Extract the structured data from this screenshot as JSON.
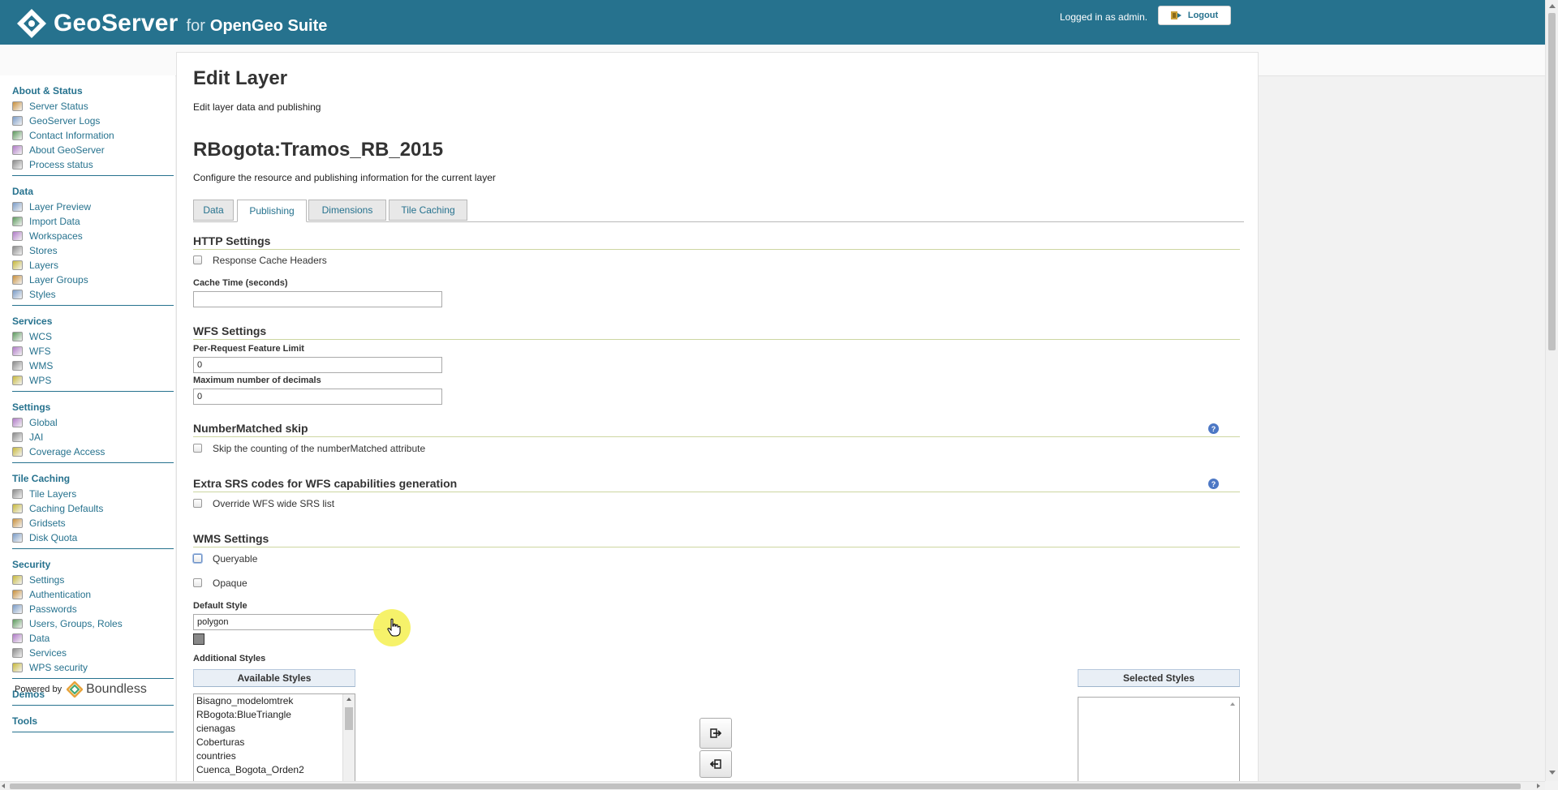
{
  "header": {
    "brand_geo": "GeoServer",
    "brand_for": "for",
    "brand_suite": "OpenGeo Suite",
    "logged_in": "Logged in as admin.",
    "logout_label": "Logout"
  },
  "sidebar": {
    "groups": [
      {
        "title": "About & Status",
        "items": [
          {
            "label": "Server Status",
            "icon": "server-status-icon"
          },
          {
            "label": "GeoServer Logs",
            "icon": "logs-icon"
          },
          {
            "label": "Contact Information",
            "icon": "contact-icon"
          },
          {
            "label": "About GeoServer",
            "icon": "info-icon"
          },
          {
            "label": "Process status",
            "icon": "gear-icon"
          }
        ]
      },
      {
        "title": "Data",
        "items": [
          {
            "label": "Layer Preview",
            "icon": "map-icon"
          },
          {
            "label": "Import Data",
            "icon": "import-icon"
          },
          {
            "label": "Workspaces",
            "icon": "folder-icon"
          },
          {
            "label": "Stores",
            "icon": "store-icon"
          },
          {
            "label": "Layers",
            "icon": "layers-icon"
          },
          {
            "label": "Layer Groups",
            "icon": "layer-group-icon"
          },
          {
            "label": "Styles",
            "icon": "palette-icon"
          }
        ]
      },
      {
        "title": "Services",
        "items": [
          {
            "label": "WCS",
            "icon": "service-icon"
          },
          {
            "label": "WFS",
            "icon": "service-icon"
          },
          {
            "label": "WMS",
            "icon": "service-icon"
          },
          {
            "label": "WPS",
            "icon": "service-icon"
          }
        ]
      },
      {
        "title": "Settings",
        "items": [
          {
            "label": "Global",
            "icon": "global-icon"
          },
          {
            "label": "JAI",
            "icon": "jai-icon"
          },
          {
            "label": "Coverage Access",
            "icon": "coverage-icon"
          }
        ]
      },
      {
        "title": "Tile Caching",
        "items": [
          {
            "label": "Tile Layers",
            "icon": "tile-layers-icon"
          },
          {
            "label": "Caching Defaults",
            "icon": "globe-icon"
          },
          {
            "label": "Gridsets",
            "icon": "grid-icon"
          },
          {
            "label": "Disk Quota",
            "icon": "disk-icon"
          }
        ]
      },
      {
        "title": "Security",
        "items": [
          {
            "label": "Settings",
            "icon": "key-icon"
          },
          {
            "label": "Authentication",
            "icon": "shield-icon"
          },
          {
            "label": "Passwords",
            "icon": "lock-icon"
          },
          {
            "label": "Users, Groups, Roles",
            "icon": "users-icon"
          },
          {
            "label": "Data",
            "icon": "data-security-icon"
          },
          {
            "label": "Services",
            "icon": "services-security-icon"
          },
          {
            "label": "WPS security",
            "icon": "wps-security-icon"
          }
        ]
      }
    ],
    "demos": "Demos",
    "tools": "Tools",
    "powered_by": "Powered by",
    "boundless": "Boundless"
  },
  "page": {
    "title": "Edit Layer",
    "subtitle": "Edit layer data and publishing",
    "layer_name": "RBogota:Tramos_RB_2015",
    "layer_desc": "Configure the resource and publishing information for the current layer"
  },
  "tabs": [
    "Data",
    "Publishing",
    "Dimensions",
    "Tile Caching"
  ],
  "active_tab": "Publishing",
  "http": {
    "title": "HTTP Settings",
    "cache_headers": "Response Cache Headers",
    "cache_time_label": "Cache Time (seconds)",
    "cache_time_value": ""
  },
  "wfs": {
    "title": "WFS Settings",
    "feature_limit_label": "Per-Request Feature Limit",
    "feature_limit_value": "0",
    "decimals_label": "Maximum number of decimals",
    "decimals_value": "0"
  },
  "number_matched": {
    "title": "NumberMatched skip",
    "skip_label": "Skip the counting of the numberMatched attribute"
  },
  "extra_srs": {
    "title": "Extra SRS codes for WFS capabilities generation",
    "override_label": "Override WFS wide SRS list"
  },
  "wms": {
    "title": "WMS Settings",
    "queryable": "Queryable",
    "opaque": "Opaque",
    "default_style_label": "Default Style",
    "default_style_value": "polygon",
    "additional_styles_label": "Additional Styles",
    "available_header": "Available Styles",
    "selected_header": "Selected Styles",
    "available_styles": [
      "Bisagno_modelomtrek",
      "RBogota:BlueTriangle",
      "cienagas",
      "Coberturas",
      "countries",
      "Cuenca_Bogota_Orden2"
    ]
  },
  "colors": {
    "header_bg": "#26728e",
    "link": "#26728e",
    "section_rule": "#cdd6a1"
  }
}
